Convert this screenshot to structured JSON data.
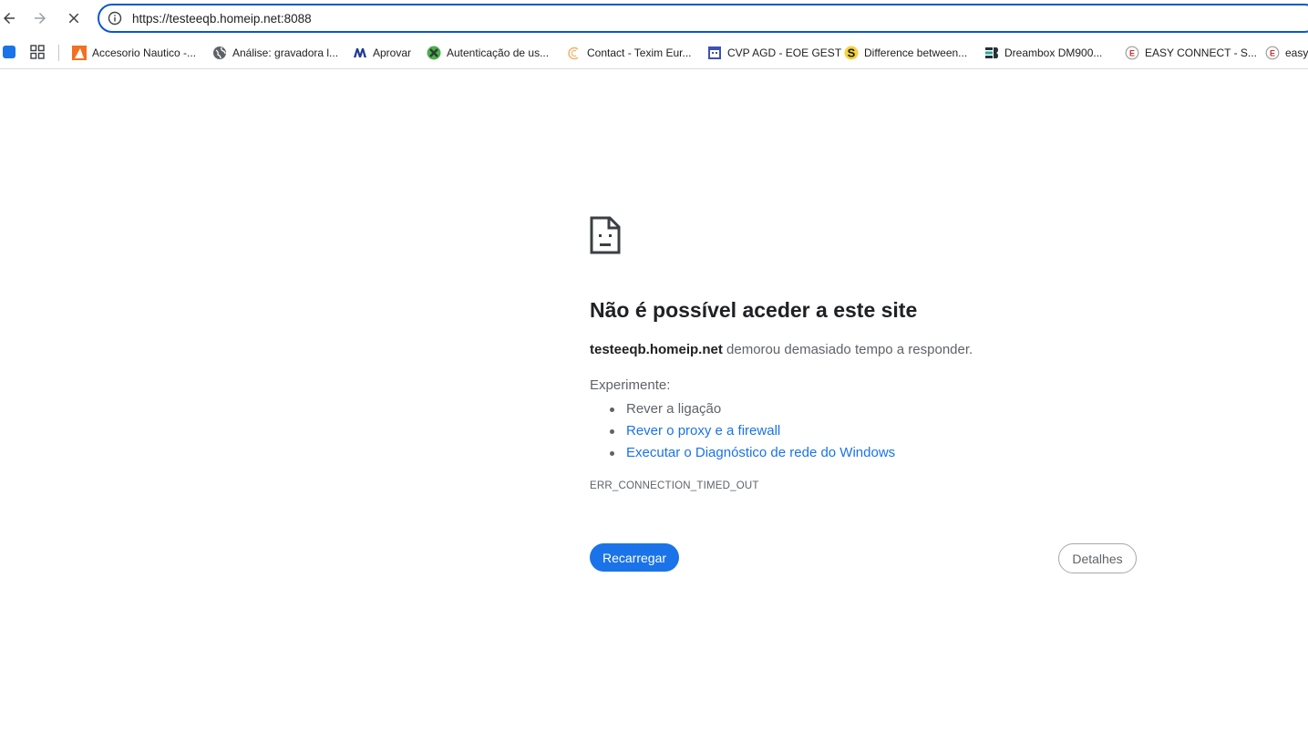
{
  "toolbar": {
    "url_scheme": "https://",
    "url_host": "testeeqb.homeip.net",
    "url_port": ":8088"
  },
  "bookmarks": [
    {
      "label": "Accesorio Nautico -...",
      "icon": "orange-triangle-icon"
    },
    {
      "label": "Análise: gravadora l...",
      "icon": "globe-icon"
    },
    {
      "label": "Aprovar",
      "icon": "blue-m-logo-icon"
    },
    {
      "label": "Autenticação de us...",
      "icon": "green-x-logo-icon"
    },
    {
      "label": "Contact - Texim Eur...",
      "icon": "orange-c-logo-icon"
    },
    {
      "label": "CVP AGD - EOE GEST",
      "icon": "calendar-icon"
    },
    {
      "label": "Difference between...",
      "icon": "s-logo-icon"
    },
    {
      "label": "Dreambox DM900...",
      "icon": "db-logo-icon"
    },
    {
      "label": "EASY CONNECT - S...",
      "icon": "e-circle-icon"
    },
    {
      "label": "easy",
      "icon": "e-circle-icon"
    }
  ],
  "error": {
    "title": "Não é possível aceder a este site",
    "host": "testeeqb.homeip.net",
    "desc_suffix": " demorou demasiado tempo a responder.",
    "try_label": "Experimente:",
    "suggestions": [
      {
        "text": "Rever a ligação",
        "link": false
      },
      {
        "text": "Rever o proxy e a firewall",
        "link": true
      },
      {
        "text": "Executar o Diagnóstico de rede do Windows",
        "link": true
      }
    ],
    "code": "ERR_CONNECTION_TIMED_OUT",
    "reload_label": "Recarregar",
    "details_label": "Detalhes"
  },
  "colors": {
    "accent": "#1a73e8",
    "omnibox_border": "#0b57d0",
    "text_secondary": "#5f6368"
  }
}
